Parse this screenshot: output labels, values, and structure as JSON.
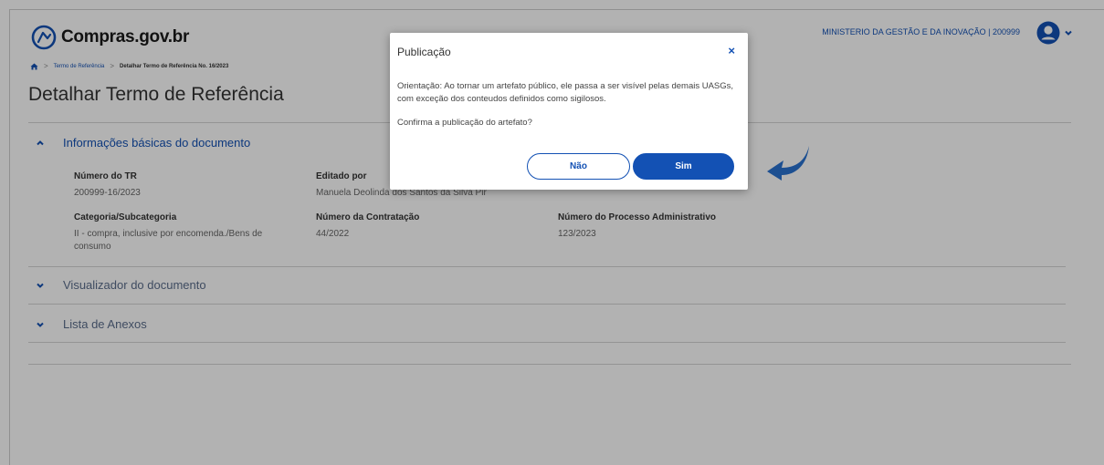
{
  "header": {
    "logo_text": "Compras.gov.br",
    "org": "MINISTERIO DA GESTÃO E DA INOVAÇÃO | 200999"
  },
  "breadcrumb": {
    "items": [
      "Termo de Referência",
      "Detalhar Termo de Referência No. 16/2023"
    ]
  },
  "page": {
    "title": "Detalhar Termo de Referência"
  },
  "sections": {
    "info": {
      "label": "Informações básicas do documento",
      "fields": [
        {
          "label": "Número do TR",
          "value": "200999-16/2023"
        },
        {
          "label": "Editado por",
          "value": "Manuela Deolinda dos Santos da Silva Pir"
        },
        {
          "label": "Categoria/Subcategoria",
          "value": "II - compra, inclusive por encomenda./Bens de consumo"
        },
        {
          "label": "Número da Contratação",
          "value": "44/2022"
        },
        {
          "label": "Número do Processo Administrativo",
          "value": "123/2023"
        }
      ]
    },
    "viewer": {
      "label": "Visualizador do documento"
    },
    "annexes": {
      "label": "Lista de Anexos"
    }
  },
  "modal": {
    "title": "Publicação",
    "close": "×",
    "message": "Orientação: Ao tornar um artefato público, ele passa a ser visível pelas demais UASGs, com exceção dos conteudos definidos como sigilosos.",
    "question": "Confirma a publicação do artefato?",
    "btn_no": "Não",
    "btn_yes": "Sim"
  },
  "colors": {
    "primary": "#1351b4",
    "overlay": "rgba(0,0,0,0.30)",
    "arrow": "#1c4f91"
  },
  "icons": [
    "compras-logo-icon",
    "home-icon",
    "user-avatar-icon",
    "chevron-down-icon",
    "chevron-up-icon",
    "close-icon",
    "pointing-arrow-icon"
  ]
}
